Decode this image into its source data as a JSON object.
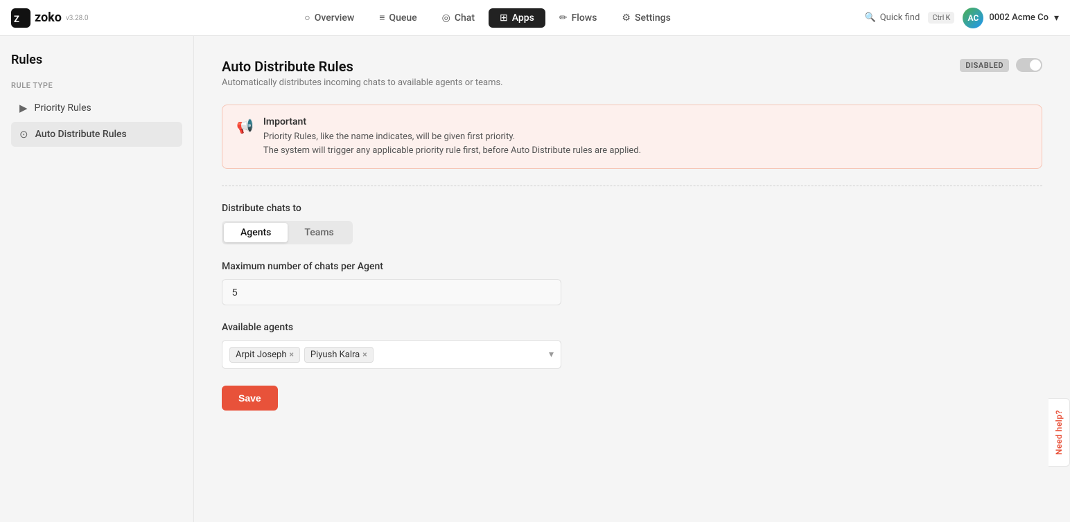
{
  "app": {
    "logo_name": "zoko",
    "logo_version": "v3.28.0"
  },
  "nav": {
    "items": [
      {
        "id": "overview",
        "label": "Overview",
        "icon": "○",
        "active": false
      },
      {
        "id": "queue",
        "label": "Queue",
        "icon": "≡",
        "active": false
      },
      {
        "id": "chat",
        "label": "Chat",
        "icon": "◎",
        "active": false
      },
      {
        "id": "apps",
        "label": "Apps",
        "icon": "⊞",
        "active": true
      },
      {
        "id": "flows",
        "label": "Flows",
        "icon": "✏",
        "active": false
      },
      {
        "id": "settings",
        "label": "Settings",
        "icon": "⚙",
        "active": false
      }
    ],
    "quick_find": "Quick find",
    "kbd_ctrl": "Ctrl",
    "kbd_k": "K",
    "account_name": "0002 Acme Co"
  },
  "sidebar": {
    "title": "Rules",
    "rule_type_label": "RULE TYPE",
    "items": [
      {
        "id": "priority-rules",
        "label": "Priority Rules",
        "icon": "▶",
        "active": false
      },
      {
        "id": "auto-distribute-rules",
        "label": "Auto Distribute Rules",
        "icon": "⊙",
        "active": true
      }
    ]
  },
  "main": {
    "page_title": "Auto Distribute Rules",
    "page_subtitle": "Automatically distributes incoming chats to available agents or teams.",
    "toggle_state": "DISABLED",
    "info_banner": {
      "title": "Important",
      "line1": "Priority Rules, like the name indicates, will be given first priority.",
      "line2": "The system will trigger any applicable priority rule first, before Auto Distribute rules are applied."
    },
    "distribute_chats_label": "Distribute chats to",
    "distribute_tabs": [
      {
        "id": "agents",
        "label": "Agents",
        "active": true
      },
      {
        "id": "teams",
        "label": "Teams",
        "active": false
      }
    ],
    "max_chats_label": "Maximum number of chats per Agent",
    "max_chats_value": "5",
    "available_agents_label": "Available agents",
    "agents": [
      {
        "id": "arpit-joseph",
        "name": "Arpit Joseph"
      },
      {
        "id": "piyush-kalra",
        "name": "Piyush Kalra"
      }
    ],
    "save_button_label": "Save",
    "need_help_label": "Need help?"
  }
}
